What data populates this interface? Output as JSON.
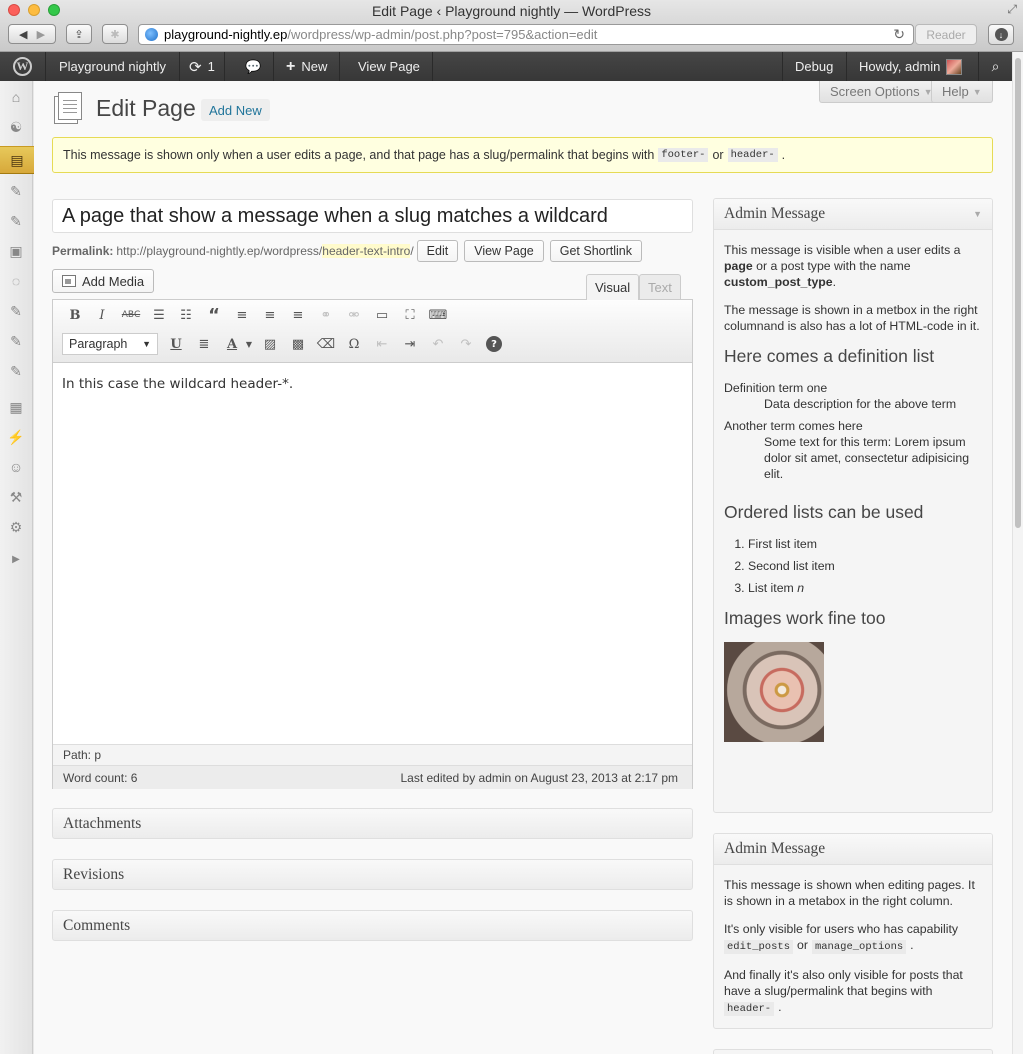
{
  "browser": {
    "window_title": "Edit Page ‹ Playground nightly — WordPress",
    "url_host": "playground-nightly.ep",
    "url_path": "/wordpress/wp-admin/post.php?post=795&action=edit",
    "reader_label": "Reader"
  },
  "adminbar": {
    "site_name": "Playground nightly",
    "updates_count": "1",
    "new_label": "New",
    "view_page_label": "View Page",
    "debug_label": "Debug",
    "howdy_label": "Howdy, admin"
  },
  "screen_options_label": "Screen Options",
  "help_label": "Help",
  "page_heading": "Edit Page",
  "add_new_label": "Add New",
  "notice": {
    "text_before": "This message is shown only when a user edits a page, and that page has a slug/permalink that begins with",
    "code1": "footer-",
    "or": "or",
    "code2": "header-",
    "text_after": "."
  },
  "post": {
    "title": "A page that show a message when a slug matches a wildcard",
    "permalink_label": "Permalink:",
    "permalink_base": "http://playground-nightly.ep/wordpress/",
    "permalink_slug": "header-text-intro",
    "permalink_end": "/",
    "edit_btn": "Edit",
    "view_page_btn": "View Page",
    "shortlink_btn": "Get Shortlink"
  },
  "editor": {
    "add_media": "Add Media",
    "tab_visual": "Visual",
    "tab_text": "Text",
    "format_select": "Paragraph",
    "content": "In this case the wildcard header-*.",
    "path": "Path: p",
    "word_count": "Word count: 6",
    "last_edited": "Last edited by admin on August 23, 2013 at 2:17 pm"
  },
  "boxes": {
    "attachments": "Attachments",
    "revisions": "Revisions",
    "comments": "Comments"
  },
  "metabox1": {
    "title": "Admin Message",
    "p1_a": "This message is visible when a user edits a ",
    "p1_b": "page",
    "p1_c": " or a post type with the name ",
    "p1_d": "custom_post_type",
    "p1_e": ".",
    "p2": "The message is shown in a metbox in the right columnand is also has a lot of HTML-code in it.",
    "h_def": "Here comes a definition list",
    "dt1": "Definition term one",
    "dd1": "Data description for the above term",
    "dt2": "Another term comes here",
    "dd2": "Some text for this term: Lorem ipsum dolor sit amet, consectetur adipisicing elit.",
    "h_ol": "Ordered lists can be used",
    "li1": "First list item",
    "li2": "Second list item",
    "li3": "List item ",
    "li3_em": "n",
    "h_img": "Images work fine too"
  },
  "metabox2": {
    "title": "Admin Message",
    "p1": "This message is shown when editing pages. It is shown in a metabox in the right column.",
    "p2_a": "It's only visible for users who has capability",
    "code1": "edit_posts",
    "or": "or",
    "code2": "manage_options",
    "p2_end": ".",
    "p3": "And finally it's also only visible for posts that have a slug/permalink that begins with",
    "code3": "header-",
    "p3_end": "."
  }
}
